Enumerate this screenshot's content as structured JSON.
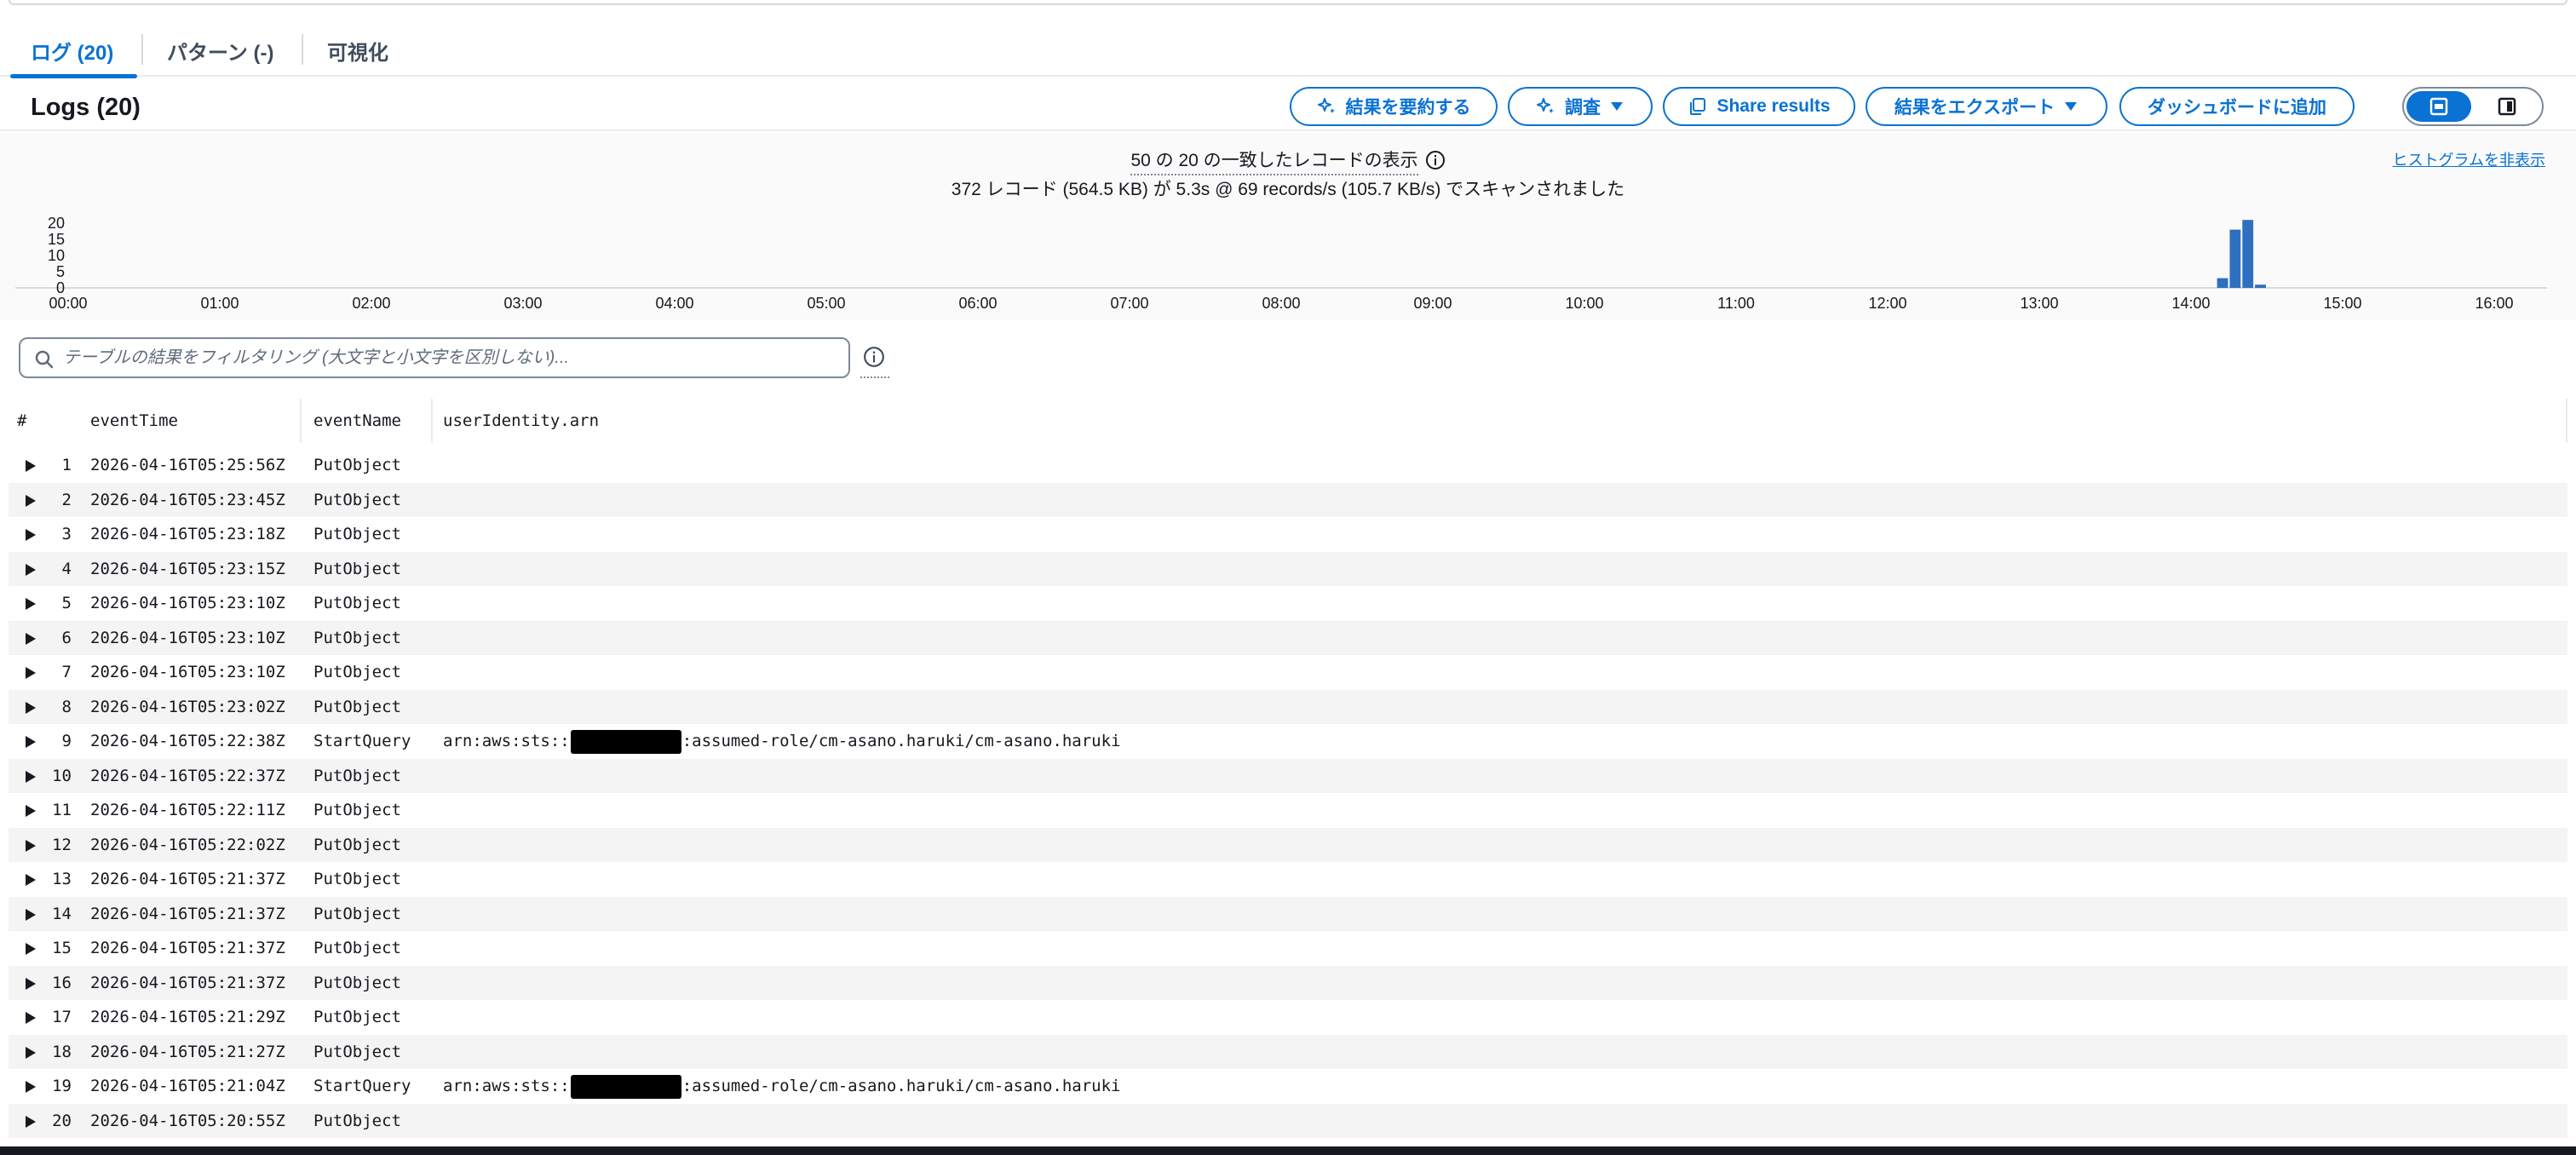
{
  "tabs": [
    {
      "label": "ログ (20)",
      "active": true
    },
    {
      "label": "パターン (-)",
      "active": false
    },
    {
      "label": "可視化",
      "active": false
    }
  ],
  "header": {
    "title": "Logs (20)",
    "buttons": {
      "summarize": "結果を要約する",
      "investigate": "調査",
      "share": "Share results",
      "export": "結果をエクスポート",
      "dashboard": "ダッシュボードに追加"
    },
    "view_toggle": {
      "icons": [
        "table-view-icon",
        "split-view-icon"
      ],
      "selected": 0
    }
  },
  "histogram": {
    "summary_matched": "50 の 20 の一致したレコードの表示",
    "summary_scanned": "372 レコード (564.5 KB) が 5.3s @ 69 records/s (105.7 KB/s) でスキャンされました",
    "hide_link": "ヒストグラムを非表示"
  },
  "chart_data": {
    "type": "bar",
    "x_tick_labels": [
      "00:00",
      "01:00",
      "02:00",
      "03:00",
      "04:00",
      "05:00",
      "06:00",
      "07:00",
      "08:00",
      "09:00",
      "10:00",
      "11:00",
      "12:00",
      "13:00",
      "14:00",
      "15:00",
      "16:00"
    ],
    "y_tick_labels": [
      "0",
      "5",
      "10",
      "15",
      "20"
    ],
    "ylim": [
      0,
      20
    ],
    "bars": [
      {
        "start": "14:10",
        "value": 3
      },
      {
        "start": "14:15",
        "value": 18
      },
      {
        "start": "14:20",
        "value": 21
      },
      {
        "start": "14:25",
        "value": 1
      }
    ],
    "color": "#2f6fbf"
  },
  "filter": {
    "placeholder": "テーブルの結果をフィルタリング (大文字と小文字を区別しない)..."
  },
  "table": {
    "columns": [
      "#",
      "eventTime",
      "eventName",
      "userIdentity.arn"
    ],
    "rows": [
      {
        "n": "1",
        "time": "2026-04-16T05:25:56Z",
        "name": "PutObject",
        "arn_prefix": "",
        "arn_suffix": "",
        "redacted": false
      },
      {
        "n": "2",
        "time": "2026-04-16T05:23:45Z",
        "name": "PutObject",
        "arn_prefix": "",
        "arn_suffix": "",
        "redacted": false
      },
      {
        "n": "3",
        "time": "2026-04-16T05:23:18Z",
        "name": "PutObject",
        "arn_prefix": "",
        "arn_suffix": "",
        "redacted": false
      },
      {
        "n": "4",
        "time": "2026-04-16T05:23:15Z",
        "name": "PutObject",
        "arn_prefix": "",
        "arn_suffix": "",
        "redacted": false
      },
      {
        "n": "5",
        "time": "2026-04-16T05:23:10Z",
        "name": "PutObject",
        "arn_prefix": "",
        "arn_suffix": "",
        "redacted": false
      },
      {
        "n": "6",
        "time": "2026-04-16T05:23:10Z",
        "name": "PutObject",
        "arn_prefix": "",
        "arn_suffix": "",
        "redacted": false
      },
      {
        "n": "7",
        "time": "2026-04-16T05:23:10Z",
        "name": "PutObject",
        "arn_prefix": "",
        "arn_suffix": "",
        "redacted": false
      },
      {
        "n": "8",
        "time": "2026-04-16T05:23:02Z",
        "name": "PutObject",
        "arn_prefix": "",
        "arn_suffix": "",
        "redacted": false
      },
      {
        "n": "9",
        "time": "2026-04-16T05:22:38Z",
        "name": "StartQuery",
        "arn_prefix": "arn:aws:sts::",
        "arn_suffix": ":assumed-role/cm-asano.haruki/cm-asano.haruki",
        "redacted": true
      },
      {
        "n": "10",
        "time": "2026-04-16T05:22:37Z",
        "name": "PutObject",
        "arn_prefix": "",
        "arn_suffix": "",
        "redacted": false
      },
      {
        "n": "11",
        "time": "2026-04-16T05:22:11Z",
        "name": "PutObject",
        "arn_prefix": "",
        "arn_suffix": "",
        "redacted": false
      },
      {
        "n": "12",
        "time": "2026-04-16T05:22:02Z",
        "name": "PutObject",
        "arn_prefix": "",
        "arn_suffix": "",
        "redacted": false
      },
      {
        "n": "13",
        "time": "2026-04-16T05:21:37Z",
        "name": "PutObject",
        "arn_prefix": "",
        "arn_suffix": "",
        "redacted": false
      },
      {
        "n": "14",
        "time": "2026-04-16T05:21:37Z",
        "name": "PutObject",
        "arn_prefix": "",
        "arn_suffix": "",
        "redacted": false
      },
      {
        "n": "15",
        "time": "2026-04-16T05:21:37Z",
        "name": "PutObject",
        "arn_prefix": "",
        "arn_suffix": "",
        "redacted": false
      },
      {
        "n": "16",
        "time": "2026-04-16T05:21:37Z",
        "name": "PutObject",
        "arn_prefix": "",
        "arn_suffix": "",
        "redacted": false
      },
      {
        "n": "17",
        "time": "2026-04-16T05:21:29Z",
        "name": "PutObject",
        "arn_prefix": "",
        "arn_suffix": "",
        "redacted": false
      },
      {
        "n": "18",
        "time": "2026-04-16T05:21:27Z",
        "name": "PutObject",
        "arn_prefix": "",
        "arn_suffix": "",
        "redacted": false
      },
      {
        "n": "19",
        "time": "2026-04-16T05:21:04Z",
        "name": "StartQuery",
        "arn_prefix": "arn:aws:sts::",
        "arn_suffix": ":assumed-role/cm-asano.haruki/cm-asano.haruki",
        "redacted": true
      },
      {
        "n": "20",
        "time": "2026-04-16T05:20:55Z",
        "name": "PutObject",
        "arn_prefix": "",
        "arn_suffix": "",
        "redacted": false
      }
    ]
  },
  "colors": {
    "accent": "#0972d3",
    "text": "#16191f",
    "bar": "#2f6fbf"
  }
}
